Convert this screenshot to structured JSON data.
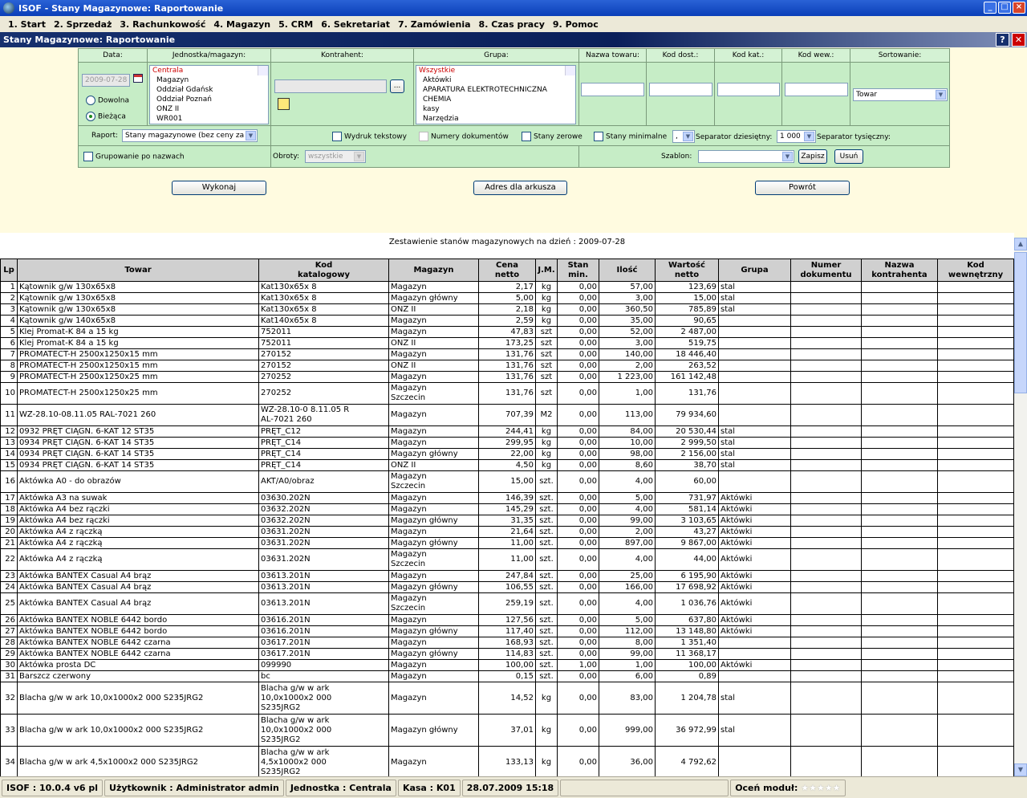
{
  "window": {
    "title": "ISOF - Stany Magazynowe: Raportowanie"
  },
  "menu": [
    "1. Start",
    "2. Sprzedaż",
    "3. Rachunkowość",
    "4. Magazyn",
    "5. CRM",
    "6. Sekretariat",
    "7. Zamówienia",
    "8. Czas pracy",
    "9. Pomoc"
  ],
  "subwindow": {
    "title": "Stany Magazynowe: Raportowanie",
    "help": "?",
    "close": "✕"
  },
  "filter": {
    "headers": {
      "data": "Data:",
      "jednostka": "Jednostka/magazyn:",
      "kontrahent": "Kontrahent:",
      "grupa": "Grupa:",
      "nazwa_towaru": "Nazwa towaru:",
      "kod_dost": "Kod dost.:",
      "kod_kat": "Kod kat.:",
      "kod_wew": "Kod wew.:",
      "sortowanie": "Sortowanie:"
    },
    "date_value": "2009-07-28",
    "radio_dowolna": "Dowolna",
    "radio_biezaca": "Bieżąca",
    "units": [
      "Centrala",
      "Magazyn",
      "Oddział Gdańsk",
      "Oddział Poznań",
      "ONZ II",
      "WR001"
    ],
    "groups": [
      "Wszystkie",
      "Aktówki",
      "APARATURA ELEKTROTECHNICZNA",
      "CHEMIA",
      "kasy",
      "Narzędzia"
    ],
    "kontrahent_btn": "...",
    "sort_value": "Towar",
    "raport_label": "Raport:",
    "raport_value": "Stany magazynowe (bez ceny za",
    "wydruk_tekstowy": "Wydruk tekstowy",
    "numery_dokumentow": "Numery dokumentów",
    "stany_zerowe": "Stany zerowe",
    "stany_minimalne": "Stany minimalne",
    "sep_dec_value": ",",
    "sep_dec_label": "Separator dziesiętny:",
    "sep_tys_value": "1 000",
    "sep_tys_label": "Separator tysięczny:",
    "grupowanie": "Grupowanie po nazwach",
    "obroty_label": "Obroty:",
    "obroty_value": "wszystkie",
    "szablon_label": "Szablon:",
    "zapisz": "Zapisz",
    "usun": "Usuń"
  },
  "actions": {
    "wykonaj": "Wykonaj",
    "adres": "Adres dla arkusza",
    "powrot": "Powrót"
  },
  "report": {
    "title": "Zestawienie stanów magazynowych na dzień : 2009-07-28",
    "columns": [
      "Lp",
      "Towar",
      "Kod\nkatalogowy",
      "Magazyn",
      "Cena\nnetto",
      "J.M.",
      "Stan\nmin.",
      "Ilość",
      "Wartość\nnetto",
      "Grupa",
      "Numer\ndokumentu",
      "Nazwa\nkontrahenta",
      "Kod\nwewnętrzny"
    ],
    "rows": [
      [
        "1",
        "Kątownik g/w 130x65x8",
        "Kat130x65x 8",
        "Magazyn",
        "2,17",
        "kg",
        "0,00",
        "57,00",
        "123,69",
        "stal"
      ],
      [
        "2",
        "Kątownik g/w 130x65x8",
        "Kat130x65x 8",
        "Magazyn główny",
        "5,00",
        "kg",
        "0,00",
        "3,00",
        "15,00",
        "stal"
      ],
      [
        "3",
        "Kątownik g/w 130x65x8",
        "Kat130x65x 8",
        "ONZ II",
        "2,18",
        "kg",
        "0,00",
        "360,50",
        "785,89",
        "stal"
      ],
      [
        "4",
        "Kątownik g/w 140x65x8",
        "Kat140x65x 8",
        "Magazyn",
        "2,59",
        "kg",
        "0,00",
        "35,00",
        "90,65",
        ""
      ],
      [
        "5",
        "Klej Promat-K 84 a 15 kg",
        "752011",
        "Magazyn",
        "47,83",
        "szt",
        "0,00",
        "52,00",
        "2 487,00",
        ""
      ],
      [
        "6",
        "Klej Promat-K 84 a 15 kg",
        "752011",
        "ONZ II",
        "173,25",
        "szt",
        "0,00",
        "3,00",
        "519,75",
        ""
      ],
      [
        "7",
        "PROMATECT-H 2500x1250x15 mm",
        "270152",
        "Magazyn",
        "131,76",
        "szt",
        "0,00",
        "140,00",
        "18 446,40",
        ""
      ],
      [
        "8",
        "PROMATECT-H 2500x1250x15 mm",
        "270152",
        "ONZ II",
        "131,76",
        "szt",
        "0,00",
        "2,00",
        "263,52",
        ""
      ],
      [
        "9",
        "PROMATECT-H 2500x1250x25 mm",
        "270252",
        "Magazyn",
        "131,76",
        "szt",
        "0,00",
        "1 223,00",
        "161 142,48",
        ""
      ],
      [
        "10",
        "PROMATECT-H 2500x1250x25 mm",
        "270252",
        "Magazyn\nSzczecin",
        "131,76",
        "szt",
        "0,00",
        "1,00",
        "131,76",
        ""
      ],
      [
        "11",
        "WZ-28.10-08.11.05 RAL-7021 260",
        "WZ-28.10-0 8.11.05 R\nAL-7021 260",
        "Magazyn",
        "707,39",
        "M2",
        "0,00",
        "113,00",
        "79 934,60",
        ""
      ],
      [
        "12",
        "0932 PRĘT CIĄGN. 6-KAT 12 ST35",
        "PRĘT_C12",
        "Magazyn",
        "244,41",
        "kg",
        "0,00",
        "84,00",
        "20 530,44",
        "stal"
      ],
      [
        "13",
        "0934 PRĘT CIĄGN. 6-KAT 14 ST35",
        "PRĘT_C14",
        "Magazyn",
        "299,95",
        "kg",
        "0,00",
        "10,00",
        "2 999,50",
        "stal"
      ],
      [
        "14",
        "0934 PRĘT CIĄGN. 6-KAT 14 ST35",
        "PRĘT_C14",
        "Magazyn główny",
        "22,00",
        "kg",
        "0,00",
        "98,00",
        "2 156,00",
        "stal"
      ],
      [
        "15",
        "0934 PRĘT CIĄGN. 6-KAT 14 ST35",
        "PRĘT_C14",
        "ONZ II",
        "4,50",
        "kg",
        "0,00",
        "8,60",
        "38,70",
        "stal"
      ],
      [
        "16",
        "Aktówka A0 - do obrazów",
        "AKT/A0/obraz",
        "Magazyn\nSzczecin",
        "15,00",
        "szt.",
        "0,00",
        "4,00",
        "60,00",
        ""
      ],
      [
        "17",
        "Aktówka A3 na suwak",
        "03630.202N",
        "Magazyn",
        "146,39",
        "szt.",
        "0,00",
        "5,00",
        "731,97",
        "Aktówki"
      ],
      [
        "18",
        "Aktówka A4 bez rączki",
        "03632.202N",
        "Magazyn",
        "145,29",
        "szt.",
        "0,00",
        "4,00",
        "581,14",
        "Aktówki"
      ],
      [
        "19",
        "Aktówka A4 bez rączki",
        "03632.202N",
        "Magazyn główny",
        "31,35",
        "szt.",
        "0,00",
        "99,00",
        "3 103,65",
        "Aktówki"
      ],
      [
        "20",
        "Aktówka A4 z rączką",
        "03631.202N",
        "Magazyn",
        "21,64",
        "szt.",
        "0,00",
        "2,00",
        "43,27",
        "Aktówki"
      ],
      [
        "21",
        "Aktówka A4 z rączką",
        "03631.202N",
        "Magazyn główny",
        "11,00",
        "szt.",
        "0,00",
        "897,00",
        "9 867,00",
        "Aktówki"
      ],
      [
        "22",
        "Aktówka A4 z rączką",
        "03631.202N",
        "Magazyn\nSzczecin",
        "11,00",
        "szt.",
        "0,00",
        "4,00",
        "44,00",
        "Aktówki"
      ],
      [
        "23",
        "Aktówka BANTEX Casual A4 brąz",
        "03613.201N",
        "Magazyn",
        "247,84",
        "szt.",
        "0,00",
        "25,00",
        "6 195,90",
        "Aktówki"
      ],
      [
        "24",
        "Aktówka BANTEX Casual A4 brąz",
        "03613.201N",
        "Magazyn główny",
        "106,55",
        "szt.",
        "0,00",
        "166,00",
        "17 698,92",
        "Aktówki"
      ],
      [
        "25",
        "Aktówka BANTEX Casual A4 brąz",
        "03613.201N",
        "Magazyn\nSzczecin",
        "259,19",
        "szt.",
        "0,00",
        "4,00",
        "1 036,76",
        "Aktówki"
      ],
      [
        "26",
        "Aktówka BANTEX NOBLE 6442 bordo",
        "03616.201N",
        "Magazyn",
        "127,56",
        "szt.",
        "0,00",
        "5,00",
        "637,80",
        "Aktówki"
      ],
      [
        "27",
        "Aktówka BANTEX NOBLE 6442 bordo",
        "03616.201N",
        "Magazyn główny",
        "117,40",
        "szt.",
        "0,00",
        "112,00",
        "13 148,80",
        "Aktówki"
      ],
      [
        "28",
        "Aktówka BANTEX NOBLE 6442 czarna",
        "03617.201N",
        "Magazyn",
        "168,93",
        "szt.",
        "0,00",
        "8,00",
        "1 351,40",
        ""
      ],
      [
        "29",
        "Aktówka BANTEX NOBLE 6442 czarna",
        "03617.201N",
        "Magazyn główny",
        "114,83",
        "szt.",
        "0,00",
        "99,00",
        "11 368,17",
        ""
      ],
      [
        "30",
        "Aktówka prosta DC",
        "099990",
        "Magazyn",
        "100,00",
        "szt.",
        "1,00",
        "1,00",
        "100,00",
        "Aktówki"
      ],
      [
        "31",
        "Barszcz czerwony",
        "bc",
        "Magazyn",
        "0,15",
        "szt.",
        "0,00",
        "6,00",
        "0,89",
        ""
      ],
      [
        "32",
        "Blacha g/w w ark 10,0x1000x2 000 S235JRG2",
        "Blacha g/w w ark\n10,0x1000x2 000\nS235JRG2",
        "Magazyn",
        "14,52",
        "kg",
        "0,00",
        "83,00",
        "1 204,78",
        "stal"
      ],
      [
        "33",
        "Blacha g/w w ark 10,0x1000x2 000 S235JRG2",
        "Blacha g/w w ark\n10,0x1000x2 000\nS235JRG2",
        "Magazyn główny",
        "37,01",
        "kg",
        "0,00",
        "999,00",
        "36 972,99",
        "stal"
      ],
      [
        "34",
        "Blacha g/w w ark 4,5x1000x2 000 S235JRG2",
        "Blacha g/w w ark\n4,5x1000x2 000\nS235JRG2",
        "Magazyn",
        "133,13",
        "kg",
        "0,00",
        "36,00",
        "4 792,62",
        ""
      ]
    ]
  },
  "status": {
    "version": "ISOF : 10.0.4 v6 pl",
    "user": "Użytkownik : Administrator admin",
    "unit": "Jednostka : Centrala",
    "kasa": "Kasa : K01",
    "datetime": "28.07.2009 15:18",
    "rate": "Oceń moduł:",
    "stars": "★★★★★"
  }
}
